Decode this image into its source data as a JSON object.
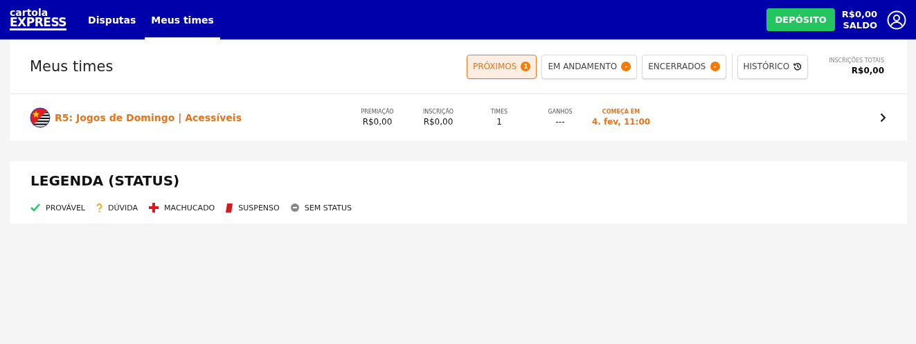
{
  "header": {
    "logo": {
      "line_1": "cartola",
      "line_2": "EXPRESS"
    },
    "nav": [
      {
        "label": "Disputas",
        "selected": false
      },
      {
        "label": "Meus times",
        "selected": true
      }
    ],
    "deposit_button": "DEPÓSITO",
    "balance": "R$0,00",
    "balance_label": "SALDO"
  },
  "page": {
    "title": "Meus times",
    "filters": [
      {
        "label": "PRÓXIMOS",
        "badge": "1",
        "selected": true,
        "kind": "badge"
      },
      {
        "label": "EM ANDAMENTO",
        "badge": "-",
        "selected": false,
        "kind": "badge"
      },
      {
        "label": "ENCERRADOS",
        "badge": "-",
        "selected": false,
        "kind": "badge"
      },
      {
        "label": "HISTÓRICO",
        "selected": false,
        "kind": "history"
      }
    ],
    "totals_label": "INSCRIÇÕES TOTAIS",
    "totals_value": "R$0,00"
  },
  "contests": [
    {
      "name": "R5: Jogos de Domingo | Acessíveis",
      "stats": [
        {
          "label": "PREMIAÇÃO",
          "value": "R$0,00",
          "highlight": false
        },
        {
          "label": "INSCRIÇÃO",
          "value": "R$0,00",
          "highlight": false
        },
        {
          "label": "TIMES",
          "value": "1",
          "highlight": false
        },
        {
          "label": "GANHOS",
          "value": "---",
          "highlight": false
        },
        {
          "label": "COMEÇA EM",
          "value": "4. fev, 11:00",
          "highlight": true
        }
      ]
    }
  ],
  "legend": {
    "title": "LEGENDA (STATUS)",
    "items": [
      {
        "kind": "provavel",
        "label": "PROVÁVEL"
      },
      {
        "kind": "duvida",
        "label": "DÚVIDA"
      },
      {
        "kind": "machucado",
        "label": "MACHUCADO"
      },
      {
        "kind": "suspenso",
        "label": "SUSPENSO"
      },
      {
        "kind": "sem_status",
        "label": "SEM STATUS"
      }
    ]
  }
}
